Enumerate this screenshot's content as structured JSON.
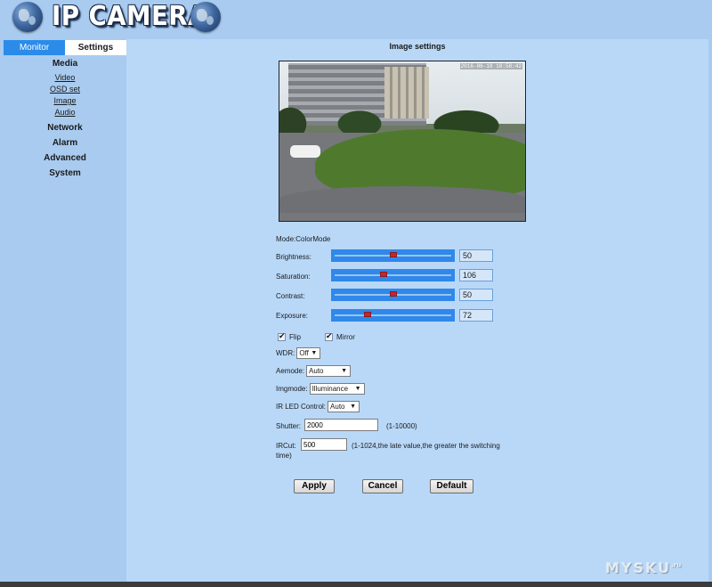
{
  "header": {
    "logo_text": "IP CAMERA"
  },
  "sidebar": {
    "tabs": {
      "monitor": "Monitor",
      "settings": "Settings"
    },
    "media": {
      "label": "Media",
      "items": [
        "Video",
        "OSD set",
        "Image",
        "Audio"
      ]
    },
    "network": "Network",
    "alarm": "Alarm",
    "advanced": "Advanced",
    "system": "System"
  },
  "page": {
    "title": "Image settings",
    "preview_timestamp": "2016-06-18 18:58:42",
    "mode": "Mode:ColorMode",
    "sliders": {
      "brightness": {
        "label": "Brightness:",
        "value": "50",
        "fraction": 0.5
      },
      "saturation": {
        "label": "Saturation:",
        "value": "106",
        "fraction": 0.42
      },
      "contrast": {
        "label": "Contrast:",
        "value": "50",
        "fraction": 0.5
      },
      "exposure": {
        "label": "Exposure:",
        "value": "72",
        "fraction": 0.28
      }
    },
    "flip": {
      "label": "Flip",
      "checked": true
    },
    "mirror": {
      "label": "Mirror",
      "checked": true
    },
    "wdr": {
      "label": "WDR:",
      "value": "Off"
    },
    "aemode": {
      "label": "Aemode:",
      "value": "Auto"
    },
    "imgmode": {
      "label": "Imgmode:",
      "value": "Illuminance"
    },
    "irled": {
      "label": "IR LED Control:",
      "value": "Auto"
    },
    "shutter": {
      "label": "Shutter:",
      "value": "2000",
      "hint": "(1-10000)"
    },
    "ircut": {
      "label": "IRCut:",
      "value": "500",
      "hint_line1": "(1-1024,the late value,the greater the switching",
      "hint_line2": "time)"
    },
    "buttons": {
      "apply": "Apply",
      "cancel": "Cancel",
      "default": "Default"
    }
  },
  "watermark": {
    "main": "MYSKU",
    "suffix": ".ru"
  },
  "colors": {
    "background": "#a9cbf0",
    "panel": "#b9d8f8",
    "slider": "#2f88ea",
    "thumb": "#c0282f",
    "tab_active": "#2b8be8"
  }
}
